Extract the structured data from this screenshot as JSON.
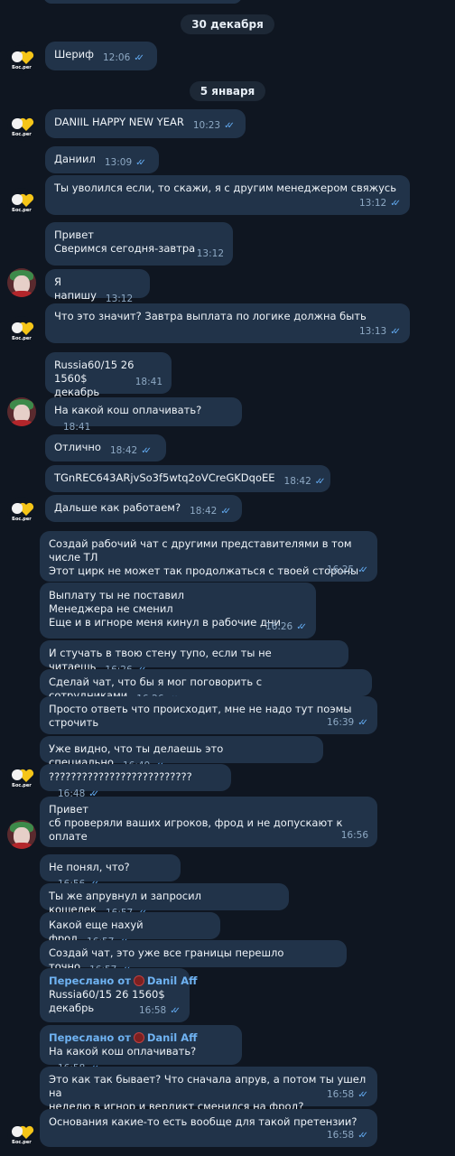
{
  "dates": {
    "d1": "30 декабря",
    "d2": "5 января"
  },
  "avatar_logo_text": "Бос.рег",
  "messages": {
    "m1": {
      "text": "Шериф",
      "time": "12:06"
    },
    "m2": {
      "text": "DANIIL HAPPY NEW YEAR",
      "time": "10:23"
    },
    "m3": {
      "text": "Даниил",
      "time": "13:09"
    },
    "m4": {
      "text": "Ты уволился если, то скажи, я с другим менеджером свяжусь",
      "time": "13:12"
    },
    "m5": {
      "text": "Привет\nСверимся сегодня-завтра",
      "time": "13:12"
    },
    "m6": {
      "text": "Я напишу",
      "time": "13:12"
    },
    "m7": {
      "text": "Что это значит? Завтра выплата по логике должна быть",
      "time": "13:13"
    },
    "m8": {
      "text": "Russia60/15 26 1560$\nдекабрь",
      "time": "18:41"
    },
    "m9": {
      "text": "На какой кош оплачивать?",
      "time": "18:41"
    },
    "m10": {
      "text": "Отлично",
      "time": "18:42"
    },
    "m11": {
      "text": "TGnREC643ARjvSo3f5wtq2oVCreGKDqoEE",
      "time": "18:42"
    },
    "m12": {
      "text": "Дальше как работаем?",
      "time": "18:42"
    },
    "m13": {
      "text": "Создай рабочий чат с другими представителями в том числе ТЛ\nЭтот цирк не может так продолжаться с твоей стороны",
      "time": "16:25"
    },
    "m14": {
      "text": "Выплату ты не поставил\nМенеджера не сменил\nЕще и в игноре меня кинул в рабочие дни",
      "time": "16:26"
    },
    "m15": {
      "text": "И стучать в твою стену тупо, если ты не читаешь",
      "time": "16:26"
    },
    "m16": {
      "text": "Сделай чат, что бы я мог поговорить с сотрудниками",
      "time": "16:26"
    },
    "m17": {
      "text": "Просто ответь что происходит, мне не надо тут поэмы строчить",
      "time": "16:39"
    },
    "m18": {
      "text": "Уже видно, что ты делаешь это специально",
      "time": "16:40"
    },
    "m19": {
      "text": "??????????????????????????",
      "time": "16:48"
    },
    "m20": {
      "text": "Привет\nсб проверяли ваших игроков, фрод и не допускают к оплате",
      "time": "16:56"
    },
    "m21": {
      "text": "Не понял, что?",
      "time": "16:56"
    },
    "m22": {
      "text": "Ты же апрувнул и запросил кошелек",
      "time": "16:57"
    },
    "m23": {
      "text": "Какой еще нахуй фрод",
      "time": "16:57"
    },
    "m24": {
      "text": "Создай чат, это уже все границы перешло точно",
      "time": "16:57"
    },
    "m25": {
      "fwd_prefix": "Переслано от",
      "fwd_name": "Danil Aff",
      "text": "Russia60/15 26 1560$\nдекабрь",
      "time": "16:58"
    },
    "m26": {
      "fwd_prefix": "Переслано от",
      "fwd_name": "Danil Aff",
      "text": "На какой кош оплачивать?",
      "time": "16:58"
    },
    "m27": {
      "text": "Это как так бывает? Что сначала апрув, а потом ты ушел на\nнеделю в игнор и вердикт сменился на фрод?",
      "time": "16:58"
    },
    "m28": {
      "text": "Основания какие-то есть вообще для такой претензии?",
      "time": "16:58"
    }
  }
}
